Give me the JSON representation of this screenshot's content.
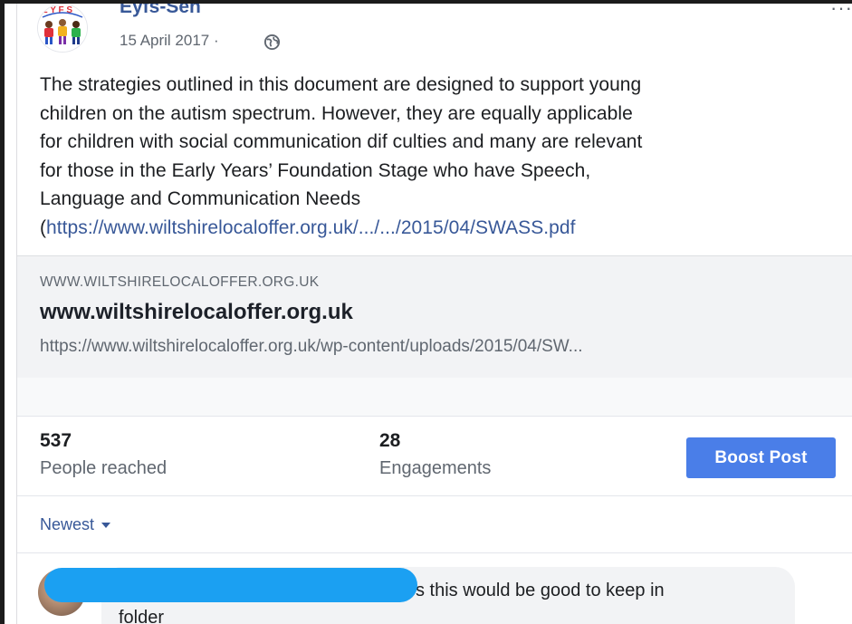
{
  "post": {
    "page_name": "Eyfs-Sen",
    "date": "15 April 2017 ·",
    "more_label": "···",
    "text_lines": [
      "The strategies outlined in this document are designed to support young",
      "children on the autism spectrum. However, they are equally applicable",
      "for children with social communication dif culties and many are relevant",
      "for those in the Early Years’ Foundation Stage who have Speech,",
      "Language and Communication Needs"
    ],
    "link_open": "(",
    "link_text": "https://www.wiltshirelocaloffer.org.uk/.../.../2015/04/SWASS.pdf"
  },
  "preview": {
    "domain": "WWW.WILTSHIRELOCALOFFER.ORG.UK",
    "title": "www.wiltshirelocaloffer.org.uk",
    "url": "https://www.wiltshirelocaloffer.org.uk/wp-content/uploads/2015/04/SW..."
  },
  "insights": {
    "reached_value": "537",
    "reached_label": "People reached",
    "engagements_value": "28",
    "engagements_label": "Engagements",
    "boost_label": "Boost Post"
  },
  "comments": {
    "sort_label": "Newest",
    "first_comment_text_line1": "s this would be good to keep in",
    "first_comment_text_line2": "folder"
  },
  "colors": {
    "link": "#385898",
    "boost": "#4a7ee8",
    "redaction": "#1ba0f2"
  },
  "icons": {
    "privacy": "globe-icon",
    "sort": "caret-down-icon"
  }
}
